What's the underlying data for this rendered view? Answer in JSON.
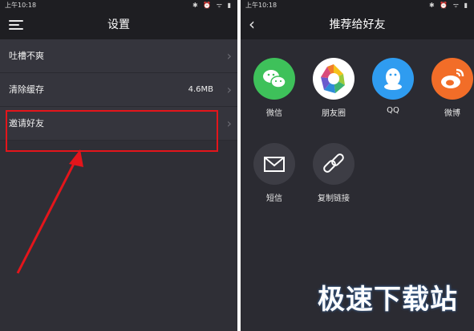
{
  "left": {
    "status_time": "上午10:18",
    "title": "设置",
    "rows": [
      {
        "label": "吐槽不爽",
        "value": ""
      },
      {
        "label": "清除缓存",
        "value": "4.6MB"
      },
      {
        "label": "邀请好友",
        "value": ""
      }
    ]
  },
  "right": {
    "status_time": "上午10:18",
    "title": "推荐给好友",
    "share_items": [
      {
        "label": "微信",
        "icon": "wechat-icon",
        "color": "#3ec15a"
      },
      {
        "label": "朋友圈",
        "icon": "moments-icon",
        "color": "#ffffff"
      },
      {
        "label": "QQ",
        "icon": "qq-icon",
        "color": "#2f9cf0"
      },
      {
        "label": "微博",
        "icon": "weibo-icon",
        "color": "#f26d28"
      },
      {
        "label": "短信",
        "icon": "sms-icon",
        "color": "#3d3d45"
      },
      {
        "label": "复制链接",
        "icon": "link-icon",
        "color": "#3d3d45"
      }
    ]
  },
  "watermark": "极速下载站",
  "colors": {
    "highlight": "#e4151b",
    "arrow": "#e4151b"
  }
}
